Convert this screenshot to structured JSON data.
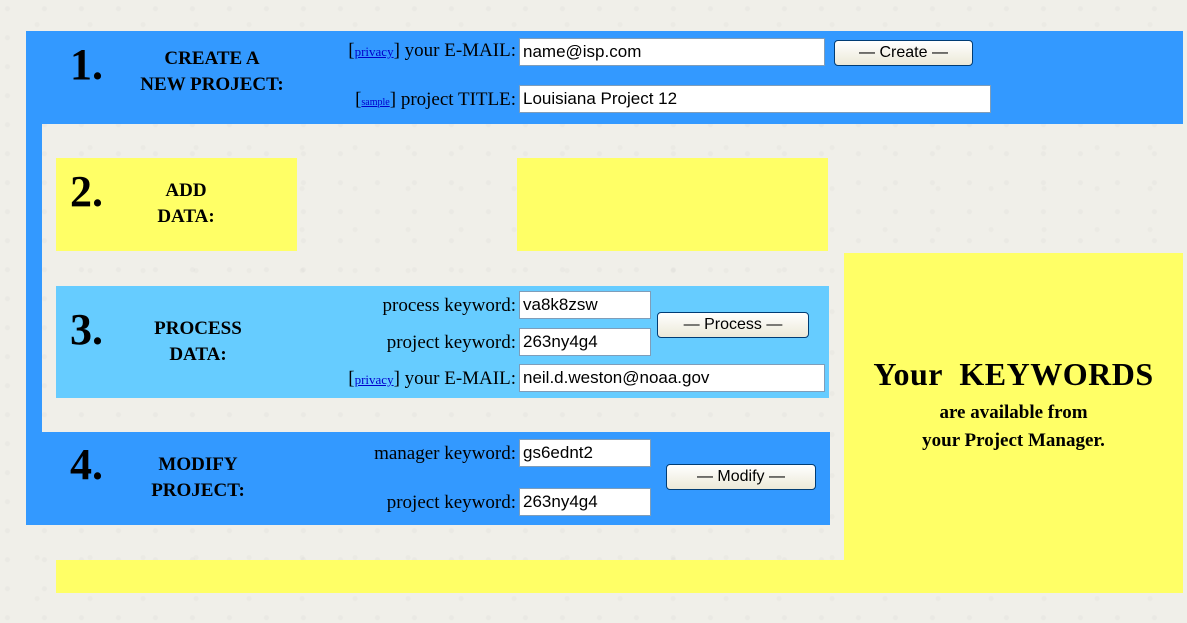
{
  "section1": {
    "number": "1.",
    "title_line1": "CREATE A",
    "title_line2": "NEW PROJECT:",
    "privacy_open": "[",
    "privacy_link": "privacy",
    "privacy_close": "]",
    "email_label": "your E-MAIL:",
    "email_value": "name@isp.com",
    "create_button": "— Create —",
    "sample_open": "[",
    "sample_link": "sample",
    "sample_close": "]",
    "title_label": "project TITLE:",
    "title_value": "Louisiana Project 12"
  },
  "section2": {
    "number": "2.",
    "title_line1": "ADD",
    "title_line2": "DATA:"
  },
  "section3": {
    "number": "3.",
    "title_line1": "PROCESS",
    "title_line2": "DATA:",
    "process_keyword_label": "process keyword:",
    "process_keyword_value": "va8k8zsw",
    "project_keyword_label": "project keyword:",
    "project_keyword_value": "263ny4g4",
    "process_button": "— Process —",
    "privacy_open": "[",
    "privacy_link": "privacy",
    "privacy_close": "]",
    "email_label": "your E-MAIL:",
    "email_value": "neil.d.weston@noaa.gov"
  },
  "section4": {
    "number": "4.",
    "title_line1": "MODIFY",
    "title_line2": "PROJECT:",
    "manager_keyword_label": "manager keyword:",
    "manager_keyword_value": "gs6ednt2",
    "project_keyword_label": "project keyword:",
    "project_keyword_value": "263ny4g4",
    "modify_button": "— Modify —"
  },
  "keywords_panel": {
    "headline": "Your  KEYWORDS",
    "line1": "are available from",
    "line2": "your Project Manager."
  },
  "colors": {
    "blue": "#3399ff",
    "light_blue": "#66ccff",
    "yellow": "#ffff66"
  }
}
